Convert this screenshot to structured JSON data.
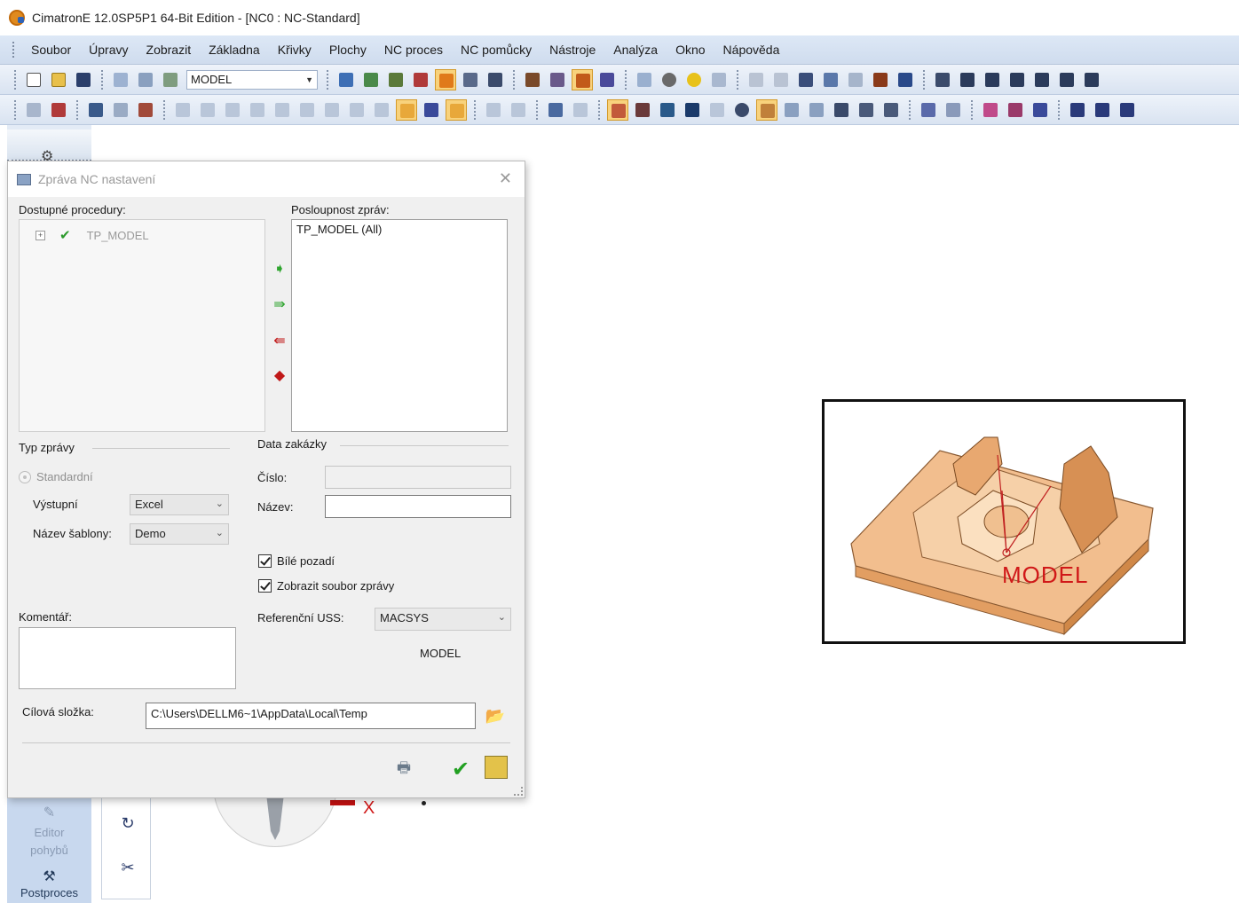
{
  "window": {
    "title": "CimatronE 12.0SP5P1  64-Bit Edition - [NC0 : NC-Standard]"
  },
  "menu": [
    "Soubor",
    "Úpravy",
    "Zobrazit",
    "Základna",
    "Křivky",
    "Plochy",
    "NC proces",
    "NC pomůcky",
    "Nástroje",
    "Analýza",
    "Okno",
    "Nápověda"
  ],
  "toolbar": {
    "model_combo": "MODEL"
  },
  "dialog": {
    "title": "Zpráva NC nastavení",
    "available_label": "Dostupné procedury:",
    "available_items": [
      "TP_MODEL"
    ],
    "sequence_label": "Posloupnost zpráv:",
    "sequence_items": [
      "TP_MODEL (All)"
    ],
    "report_type_label": "Typ zprávy",
    "standard_label": "Standardní",
    "output_label": "Výstupní",
    "output_value": "Excel",
    "template_label": "Název šablony:",
    "template_value": "Demo",
    "order_data_label": "Data zakázky",
    "number_label": "Číslo:",
    "number_value": "",
    "name_label": "Název:",
    "name_value": "",
    "white_bg_label": "Bílé pozadí",
    "white_bg_checked": true,
    "show_file_label": "Zobrazit soubor zprávy",
    "show_file_checked": true,
    "comment_label": "Komentář:",
    "comment_value": "",
    "ref_uss_label": "Referenční USS:",
    "ref_uss_value": "MACSYS",
    "model_label": "MODEL",
    "target_folder_label": "Cílová složka:",
    "target_folder_value": "C:\\Users\\DELLM6~1\\AppData\\Local\\Temp"
  },
  "left_panel": {
    "editor_label_1": "Editor",
    "editor_label_2": "pohybů",
    "postprocess_label": "Postproces"
  },
  "viewport": {
    "preview_label": "MODEL",
    "axis_x_label": "X",
    "model_color": "#f0b889"
  }
}
